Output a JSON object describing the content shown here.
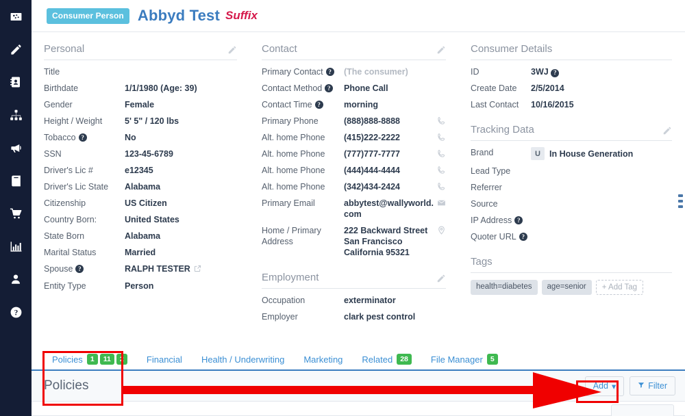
{
  "sidebar": {
    "items": [
      {
        "name": "dashboard-icon",
        "label": "Dashboard"
      },
      {
        "name": "pencil-icon",
        "label": "Edit"
      },
      {
        "name": "address-book-icon",
        "label": "Contacts"
      },
      {
        "name": "sitemap-icon",
        "label": "Hierarchy"
      },
      {
        "name": "megaphone-icon",
        "label": "Marketing"
      },
      {
        "name": "book-icon",
        "label": "Library"
      },
      {
        "name": "cart-icon",
        "label": "Orders"
      },
      {
        "name": "bar-chart-icon",
        "label": "Reports"
      },
      {
        "name": "user-icon",
        "label": "Account"
      },
      {
        "name": "help-icon",
        "label": "Help"
      }
    ]
  },
  "header": {
    "type_badge": "Consumer Person",
    "name": "Abbyd Test",
    "suffix": "Suffix"
  },
  "personal": {
    "title": "Personal",
    "rows": [
      {
        "label": "Title",
        "value": ""
      },
      {
        "label": "Birthdate",
        "value": "1/1/1980 (Age: 39)"
      },
      {
        "label": "Gender",
        "value": "Female"
      },
      {
        "label": "Height / Weight",
        "value": "5' 5\" / 120 lbs"
      },
      {
        "label": "Tobacco",
        "value": "No",
        "help": true
      },
      {
        "label": "SSN",
        "value": "123-45-6789"
      },
      {
        "label": "Driver's Lic #",
        "value": "e12345"
      },
      {
        "label": "Driver's Lic State",
        "value": "Alabama"
      },
      {
        "label": "Citizenship",
        "value": "US Citizen"
      },
      {
        "label": "Country Born:",
        "value": "United States"
      },
      {
        "label": "State Born",
        "value": "Alabama"
      },
      {
        "label": "Marital Status",
        "value": "Married"
      },
      {
        "label": "Spouse",
        "value": "RALPH TESTER",
        "help": true,
        "external": true
      },
      {
        "label": "Entity Type",
        "value": "Person"
      }
    ]
  },
  "contact": {
    "title": "Contact",
    "rows": [
      {
        "label": "Primary Contact",
        "value": "(The consumer)",
        "help": true,
        "muted": true
      },
      {
        "label": "Contact Method",
        "value": "Phone Call",
        "help": true
      },
      {
        "label": "Contact Time",
        "value": "morning",
        "help": true
      },
      {
        "label": "Primary Phone",
        "value": "(888)888-8888",
        "action": "phone-icon"
      },
      {
        "label": "Alt. home Phone",
        "value": "(415)222-2222",
        "action": "phone-icon"
      },
      {
        "label": "Alt. home Phone",
        "value": "(777)777-7777",
        "action": "phone-icon"
      },
      {
        "label": "Alt. home Phone",
        "value": "(444)444-4444",
        "action": "phone-icon"
      },
      {
        "label": "Alt. home Phone",
        "value": "(342)434-2424",
        "action": "phone-icon"
      },
      {
        "label": "Primary Email",
        "value": "abbytest@wallyworld.com",
        "action": "envelope-icon"
      },
      {
        "label": "Home / Primary Address",
        "value": "222 Backward Street San Francisco California 95321",
        "action": "map-pin-icon"
      }
    ]
  },
  "employment": {
    "title": "Employment",
    "rows": [
      {
        "label": "Occupation",
        "value": "exterminator"
      },
      {
        "label": "Employer",
        "value": "clark pest control"
      }
    ]
  },
  "consumer_details": {
    "title": "Consumer Details",
    "rows": [
      {
        "label": "ID",
        "value": "3WJ",
        "value_help": true
      },
      {
        "label": "Create Date",
        "value": "2/5/2014"
      },
      {
        "label": "Last Contact",
        "value": "10/16/2015"
      }
    ]
  },
  "tracking_data": {
    "title": "Tracking Data",
    "brand_label": "Brand",
    "brand_initial": "U",
    "brand_value": "In House Generation",
    "rows": [
      {
        "label": "Lead Type",
        "value": ""
      },
      {
        "label": "Referrer",
        "value": ""
      },
      {
        "label": "Source",
        "value": ""
      },
      {
        "label": "IP Address",
        "value": "",
        "help": true
      },
      {
        "label": "Quoter URL",
        "value": "",
        "help": true
      }
    ]
  },
  "tags": {
    "title": "Tags",
    "items": [
      "health=diabetes",
      "age=senior"
    ],
    "add_label": "+ Add Tag"
  },
  "tabs": [
    {
      "label": "Policies",
      "badges": [
        "1",
        "11",
        "2"
      ],
      "active": true
    },
    {
      "label": "Financial",
      "badges": []
    },
    {
      "label": "Health / Underwriting",
      "badges": []
    },
    {
      "label": "Marketing",
      "badges": []
    },
    {
      "label": "Related",
      "badges": [
        "28"
      ]
    },
    {
      "label": "File Manager",
      "badges": [
        "5"
      ]
    }
  ],
  "panel": {
    "title": "Policies",
    "add_label": "Add",
    "add_caret": "▾",
    "filter_label": "Filter"
  },
  "colors": {
    "sidebar_bg": "#141d35",
    "accent_blue": "#3b8fd4",
    "name_blue": "#3b7cbf",
    "badge_blue": "#5bc0de",
    "suffix_red": "#d5194b",
    "badge_green": "#3fb950",
    "annotation_red": "#f00000"
  }
}
